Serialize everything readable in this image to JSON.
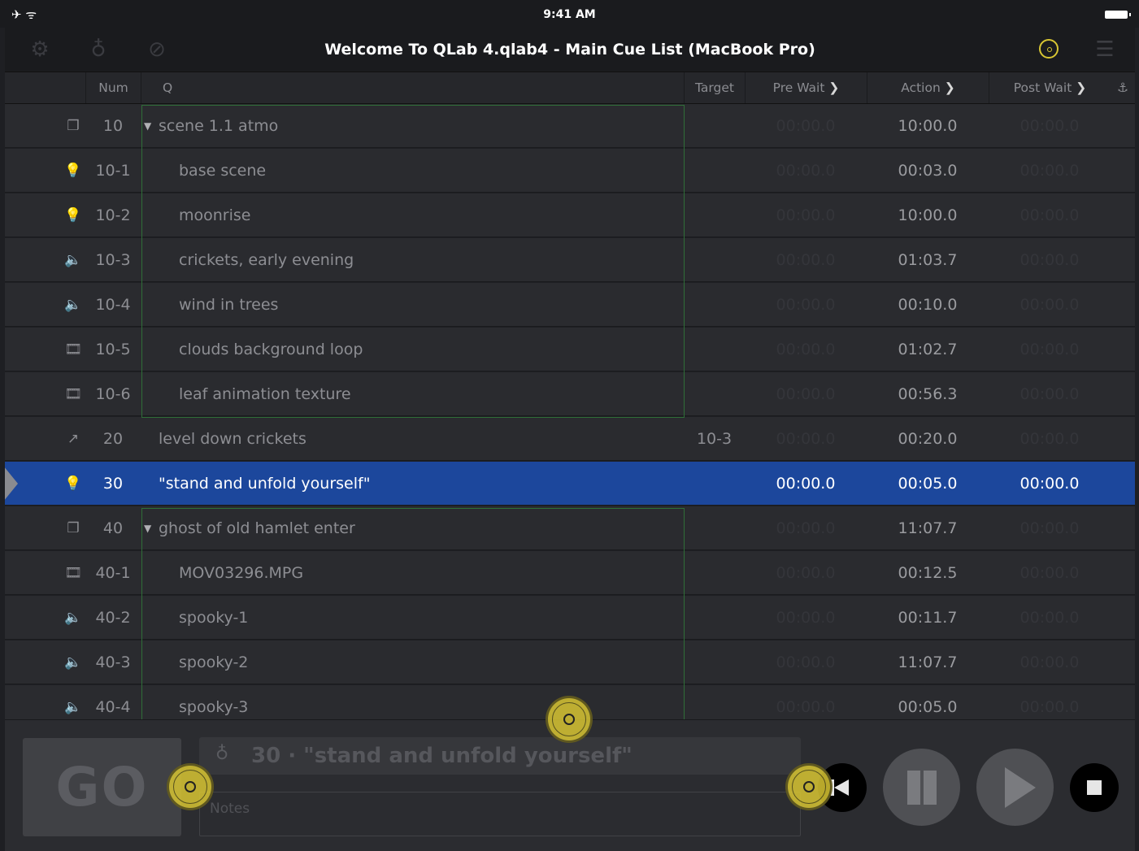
{
  "status_bar": {
    "time": "9:41 AM",
    "airplane": "✈",
    "wifi": "wifi-icon"
  },
  "toolbar": {
    "title": "Welcome To QLab 4.qlab4 - Main Cue List (MacBook Pro)",
    "icons": [
      "gear-icon",
      "lightbulb-icon",
      "skip-icon",
      "target-icon",
      "list-icon"
    ]
  },
  "columns": {
    "num": "Num",
    "q": "Q",
    "target": "Target",
    "pre_wait": "Pre Wait",
    "action": "Action",
    "post_wait": "Post Wait",
    "chevron": "❯",
    "anchor": "⚓"
  },
  "cues": [
    {
      "icon": "❐",
      "num": "10",
      "q": "scene 1.1 atmo",
      "target": "",
      "pre": "00:00.0",
      "action": "10:00.0",
      "post": "00:00.0",
      "group": true
    },
    {
      "icon": "💡",
      "num": "10-1",
      "q": "base scene",
      "target": "",
      "pre": "00:00.0",
      "action": "00:03.0",
      "post": "00:00.0"
    },
    {
      "icon": "💡",
      "num": "10-2",
      "q": "moonrise",
      "target": "",
      "pre": "00:00.0",
      "action": "10:00.0",
      "post": "00:00.0"
    },
    {
      "icon": "🔈",
      "num": "10-3",
      "q": "crickets, early evening",
      "target": "",
      "pre": "00:00.0",
      "action": "01:03.7",
      "post": "00:00.0"
    },
    {
      "icon": "🔈",
      "num": "10-4",
      "q": "wind in trees",
      "target": "",
      "pre": "00:00.0",
      "action": "00:10.0",
      "post": "00:00.0"
    },
    {
      "icon": "🎞",
      "num": "10-5",
      "q": "clouds background loop",
      "target": "",
      "pre": "00:00.0",
      "action": "01:02.7",
      "post": "00:00.0"
    },
    {
      "icon": "🎞",
      "num": "10-6",
      "q": "leaf animation texture",
      "target": "",
      "pre": "00:00.0",
      "action": "00:56.3",
      "post": "00:00.0"
    },
    {
      "icon": "↗",
      "num": "20",
      "q": "level down crickets",
      "target": "10-3",
      "pre": "00:00.0",
      "action": "00:20.0",
      "post": "00:00.0"
    },
    {
      "icon": "💡",
      "num": "30",
      "q": "\"stand and unfold yourself\"",
      "target": "",
      "pre": "00:00.0",
      "action": "00:05.0",
      "post": "00:00.0",
      "selected": true
    },
    {
      "icon": "❐",
      "num": "40",
      "q": "ghost of old hamlet enter",
      "target": "",
      "pre": "00:00.0",
      "action": "11:07.7",
      "post": "00:00.0",
      "group": true
    },
    {
      "icon": "🎞",
      "num": "40-1",
      "q": "MOV03296.MPG",
      "target": "",
      "pre": "00:00.0",
      "action": "00:12.5",
      "post": "00:00.0"
    },
    {
      "icon": "🔈",
      "num": "40-2",
      "q": "spooky-1",
      "target": "",
      "pre": "00:00.0",
      "action": "00:11.7",
      "post": "00:00.0"
    },
    {
      "icon": "🔈",
      "num": "40-3",
      "q": "spooky-2",
      "target": "",
      "pre": "00:00.0",
      "action": "11:07.7",
      "post": "00:00.0"
    },
    {
      "icon": "🔈",
      "num": "40-4",
      "q": "spooky-3",
      "target": "",
      "pre": "00:00.0",
      "action": "00:05.0",
      "post": "00:00.0"
    }
  ],
  "bottom": {
    "go_label": "GO",
    "current_cue": "30 · \"stand and unfold yourself\"",
    "notes_placeholder": "Notes"
  },
  "colors": {
    "accent": "#d8c633",
    "selection": "#1c479c",
    "group_border": "#2f6e38"
  }
}
